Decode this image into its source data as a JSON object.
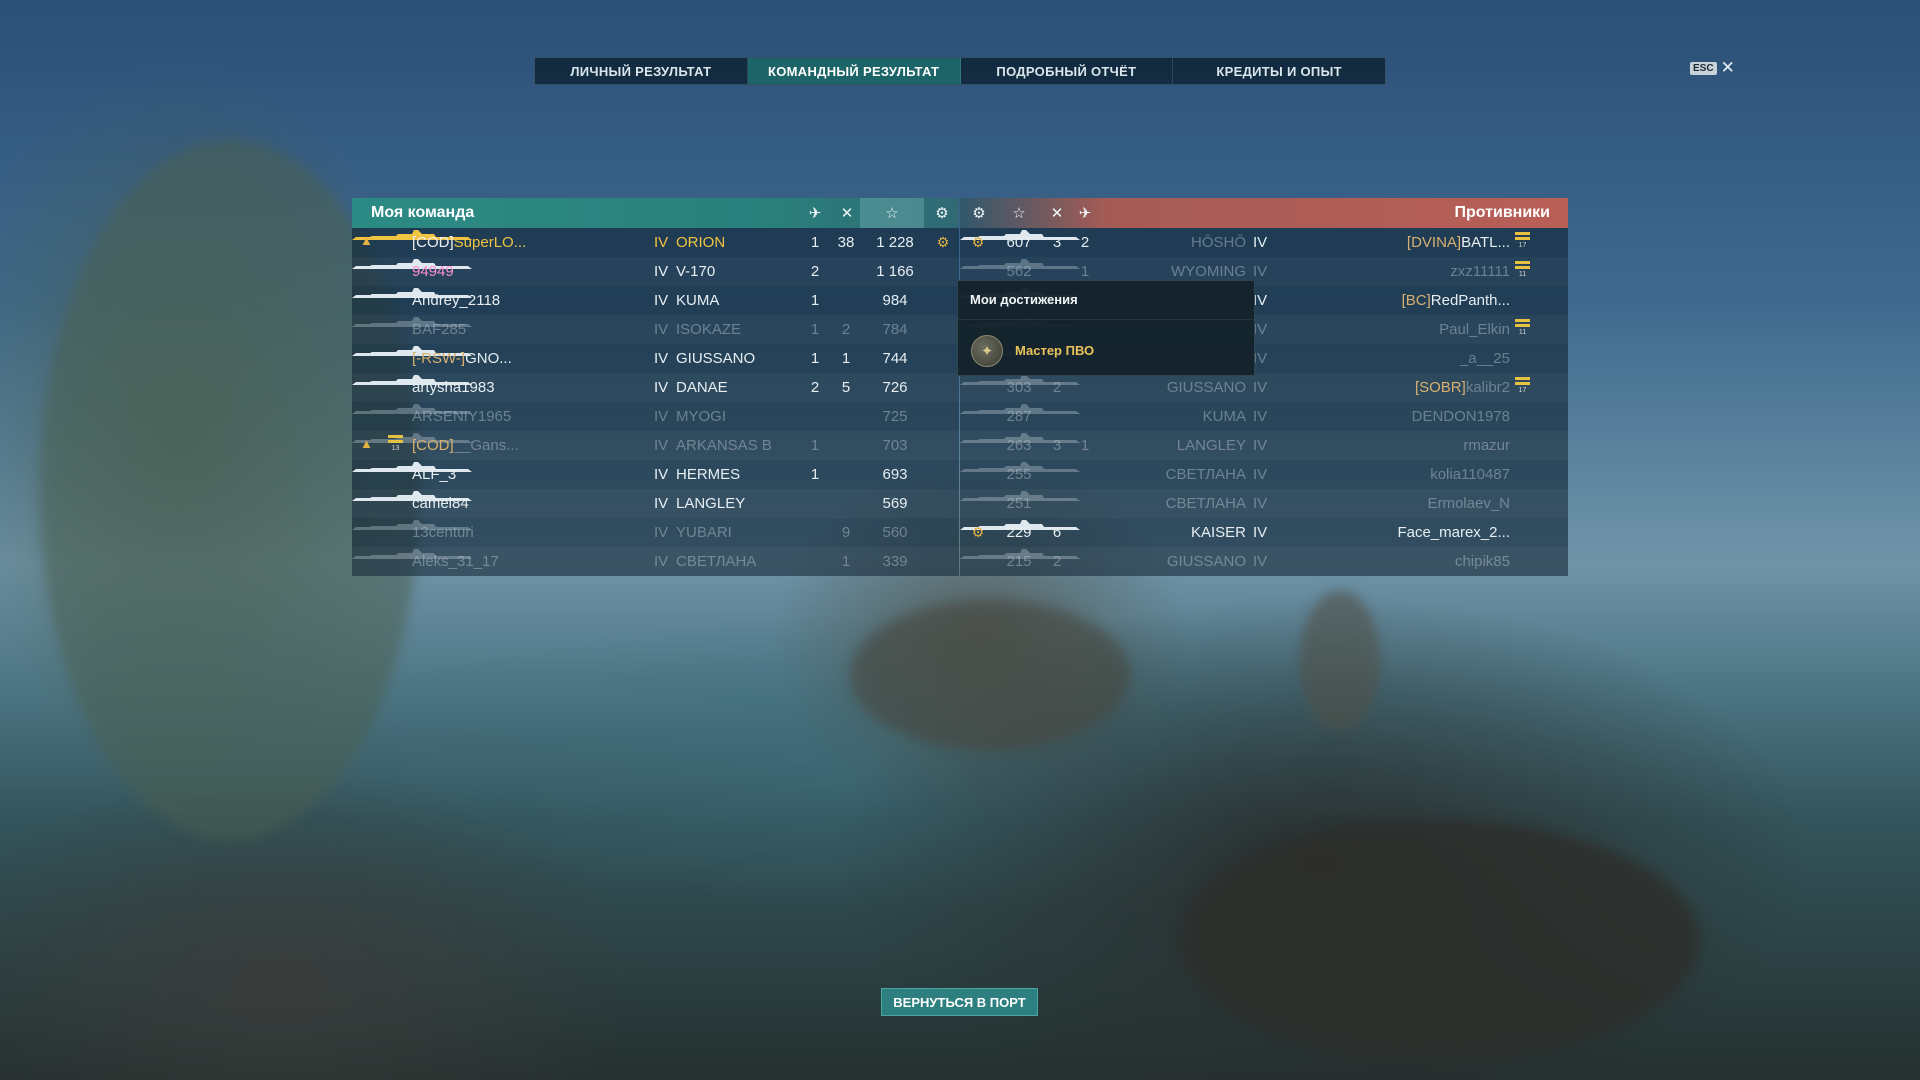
{
  "tabs": [
    {
      "label": "ЛИЧНЫЙ РЕЗУЛЬТАТ",
      "active": false
    },
    {
      "label": "КОМАНДНЫЙ РЕЗУЛЬТАТ",
      "active": true
    },
    {
      "label": "ПОДРОБНЫЙ ОТЧЁТ",
      "active": false
    },
    {
      "label": "КРЕДИТЫ И ОПЫТ",
      "active": false
    }
  ],
  "esc": {
    "key": "ESC",
    "close": "✕"
  },
  "my_team": {
    "title": "Моя команда",
    "header_icons": [
      "planes-destroyed-icon",
      "kills-icon",
      "star-icon",
      "achievement-icon"
    ],
    "rows": [
      {
        "rank_icon": true,
        "flag": "",
        "clan": "[COD]",
        "player": "SuperLO...",
        "tier": "IV",
        "ship": "ORION",
        "planes": "1",
        "kills": "38",
        "xp": "1 228",
        "ach": true,
        "self": true,
        "dim": false
      },
      {
        "rank_icon": false,
        "flag": "",
        "clan": "",
        "player": "94949",
        "tier": "IV",
        "ship": "V-170",
        "planes": "2",
        "kills": "",
        "xp": "1 166",
        "ach": false,
        "pink": true,
        "dim": false
      },
      {
        "rank_icon": false,
        "flag": "",
        "clan": "",
        "player": "Andrey_2118",
        "tier": "IV",
        "ship": "KUMA",
        "planes": "1",
        "kills": "",
        "xp": "984",
        "ach": false,
        "dim": false
      },
      {
        "rank_icon": false,
        "flag": "",
        "clan": "",
        "player": "BAF285",
        "tier": "IV",
        "ship": "ISOKAZE",
        "planes": "1",
        "kills": "2",
        "xp": "784",
        "ach": false,
        "dim": true
      },
      {
        "rank_icon": false,
        "flag": "",
        "clan": "[-RSW-]",
        "player": "GNO...",
        "tier": "IV",
        "ship": "GIUSSANO",
        "planes": "1",
        "kills": "1",
        "xp": "744",
        "ach": false,
        "dim": false
      },
      {
        "rank_icon": false,
        "flag": "",
        "clan": "",
        "player": "artysha1983",
        "tier": "IV",
        "ship": "DANAE",
        "planes": "2",
        "kills": "5",
        "xp": "726",
        "ach": false,
        "dim": false
      },
      {
        "rank_icon": false,
        "flag": "",
        "clan": "",
        "player": "ARSENIY1965",
        "tier": "IV",
        "ship": "MYOGI",
        "planes": "",
        "kills": "",
        "xp": "725",
        "ach": false,
        "dim": true
      },
      {
        "rank_icon": true,
        "flag": "13",
        "clan": "[COD]",
        "player": "__Gans...",
        "tier": "IV",
        "ship": "ARKANSAS B",
        "planes": "1",
        "kills": "",
        "xp": "703",
        "ach": false,
        "dim": true
      },
      {
        "rank_icon": false,
        "flag": "",
        "clan": "",
        "player": "ALF_3",
        "tier": "IV",
        "ship": "HERMES",
        "planes": "1",
        "kills": "",
        "xp": "693",
        "ach": false,
        "dim": false
      },
      {
        "rank_icon": false,
        "flag": "",
        "clan": "",
        "player": "camel84",
        "tier": "IV",
        "ship": "LANGLEY",
        "planes": "",
        "kills": "",
        "xp": "569",
        "ach": false,
        "dim": false
      },
      {
        "rank_icon": false,
        "flag": "",
        "clan": "",
        "player": "13centuri",
        "tier": "IV",
        "ship": "YUBARI",
        "planes": "",
        "kills": "9",
        "xp": "560",
        "ach": false,
        "dim": true
      },
      {
        "rank_icon": false,
        "flag": "",
        "clan": "",
        "player": "Aleks_31_17",
        "tier": "IV",
        "ship": "СВЕТЛАНА",
        "planes": "",
        "kills": "1",
        "xp": "339",
        "ach": false,
        "dim": true
      }
    ]
  },
  "enemy_team": {
    "title": "Противники",
    "header_icons": [
      "achievement-icon",
      "star-icon",
      "kills-icon",
      "planes-destroyed-icon"
    ],
    "rows": [
      {
        "ach": true,
        "xp": "607",
        "kills": "3",
        "planes": "2",
        "ship": "HŌSHŌ",
        "tier": "IV",
        "clan": "[DVINA]",
        "player": "BATL...",
        "flag": "17",
        "dim": false,
        "ship_dim": true
      },
      {
        "ach": false,
        "xp": "562",
        "kills": "",
        "planes": "1",
        "ship": "WYOMING",
        "tier": "IV",
        "clan": "",
        "player": "zxz11111",
        "flag": "11",
        "dim": true
      },
      {
        "ach": false,
        "xp": "",
        "kills": "",
        "planes": "",
        "ship": "",
        "tier": "IV",
        "clan": "[BC]",
        "player": "RedPanth...",
        "flag": "",
        "dim": false
      },
      {
        "ach": false,
        "xp": "",
        "kills": "",
        "planes": "",
        "ship": "",
        "tier": "IV",
        "clan": "",
        "player": "Paul_Elkin",
        "flag": "11",
        "dim": true
      },
      {
        "ach": false,
        "xp": "",
        "kills": "",
        "planes": "",
        "ship": "",
        "tier": "IV",
        "clan": "",
        "player": "_a__25",
        "flag": "",
        "dim": true
      },
      {
        "ach": false,
        "xp": "303",
        "kills": "2",
        "planes": "",
        "ship": "GIUSSANO",
        "tier": "IV",
        "clan": "[SOBR]",
        "player": "kalibr2",
        "flag": "17",
        "dim": true
      },
      {
        "ach": false,
        "xp": "287",
        "kills": "",
        "planes": "",
        "ship": "KUMA",
        "tier": "IV",
        "clan": "",
        "player": "DENDON1978",
        "flag": "",
        "dim": true
      },
      {
        "ach": false,
        "xp": "263",
        "kills": "3",
        "planes": "1",
        "ship": "LANGLEY",
        "tier": "IV",
        "clan": "",
        "player": "rmazur",
        "flag": "",
        "dim": true
      },
      {
        "ach": false,
        "xp": "255",
        "kills": "",
        "planes": "",
        "ship": "СВЕТЛАНА",
        "tier": "IV",
        "clan": "",
        "player": "kolia110487",
        "flag": "",
        "dim": true
      },
      {
        "ach": false,
        "xp": "251",
        "kills": "",
        "planes": "",
        "ship": "СВЕТЛАНА",
        "tier": "IV",
        "clan": "",
        "player": "Ermolaev_N",
        "flag": "",
        "dim": true
      },
      {
        "ach": true,
        "xp": "229",
        "kills": "6",
        "planes": "",
        "ship": "KAISER",
        "tier": "IV",
        "clan": "",
        "player": "Face_marex_2...",
        "flag": "",
        "dim": false
      },
      {
        "ach": false,
        "xp": "215",
        "kills": "2",
        "planes": "",
        "ship": "GIUSSANO",
        "tier": "IV",
        "clan": "",
        "player": "chipik85",
        "flag": "",
        "dim": true
      }
    ]
  },
  "tooltip": {
    "title": "Мои достижения",
    "achievement": "Мастер ПВО"
  },
  "back_button": "ВЕРНУТЬСЯ В ПОРТ",
  "colors": {
    "accent": "#2c8b84",
    "enemy": "#b85f57",
    "gold": "#e7c44f",
    "self": "#f0c340"
  }
}
